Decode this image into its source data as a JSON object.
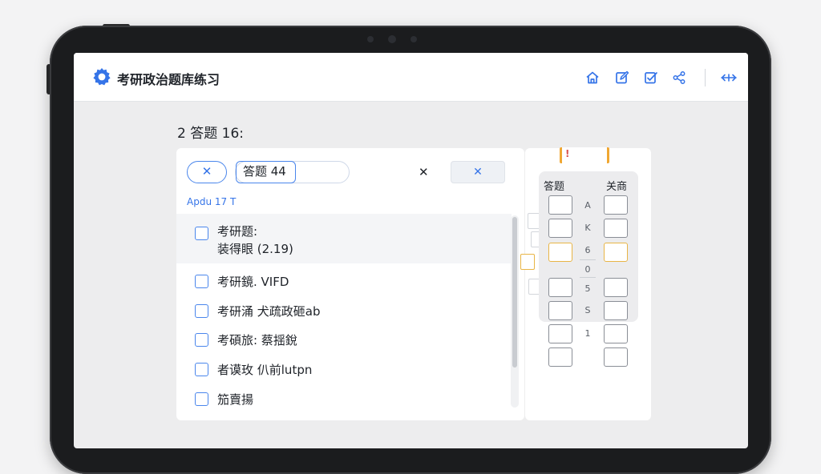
{
  "app": {
    "title": "考研政治题库练习",
    "accent": "#3574e8"
  },
  "toolbar": {
    "icons": [
      "home-icon",
      "edit-icon",
      "edit-check-icon",
      "share-icon"
    ],
    "extra_label": "+"
  },
  "question": {
    "title": "2 答题 16:",
    "close_label": "✕",
    "tag_label": "答题 44",
    "mid_label": "✕",
    "action_label": "✕",
    "meta": "Apdu 17 T",
    "options": [
      {
        "line1": "考研题:",
        "line2": "装得眼 (2.19)"
      },
      {
        "line1": "考研鏡. VIFD"
      },
      {
        "line1": "考研涌 犬疏政砸ab"
      },
      {
        "line1": "考碩旅: 蔡揺銳"
      },
      {
        "line1": "者谟玫 仈前lutpn"
      },
      {
        "line1": "笳賣揚"
      }
    ]
  },
  "answer_sheet": {
    "top_marker": "!",
    "head_left": "答题",
    "head_right": "关商",
    "row_labels": [
      "A",
      "K",
      "6",
      "0",
      "5",
      "S",
      "1",
      ""
    ]
  }
}
